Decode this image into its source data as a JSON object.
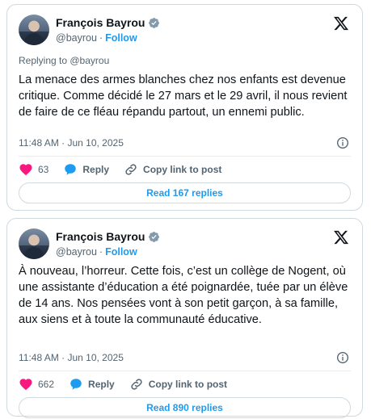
{
  "tweets": [
    {
      "author_name": "François Bayrou",
      "handle": "@bayrou",
      "separator": "·",
      "follow_label": "Follow",
      "replying_to": "Replying to @bayrou",
      "text": "La menace des armes blanches chez nos enfants est devenue critique. Comme décidé le 27 mars et le 29 avril, il nous revient de faire de ce fléau répandu partout, un ennemi public.",
      "timestamp": "11:48 AM · Jun 10, 2025",
      "likes": "63",
      "reply_label": "Reply",
      "copy_label": "Copy link to post",
      "read_replies_label": "Read 167 replies"
    },
    {
      "author_name": "François Bayrou",
      "handle": "@bayrou",
      "separator": "·",
      "follow_label": "Follow",
      "text": "À nouveau, l’horreur. Cette fois, c’est un collège de Nogent, où une assistante d’éducation a été poignardée, tuée par un élève de 14 ans. Nos pensées vont à son petit garçon, à sa famille, aux siens et à toute la communauté éducative.",
      "timestamp": "11:48 AM · Jun 10, 2025",
      "likes": "662",
      "reply_label": "Reply",
      "copy_label": "Copy link to post",
      "read_replies_label": "Read 890 replies"
    }
  ],
  "colors": {
    "accent": "#1d9bf0",
    "like": "#f91880",
    "text": "#0f1419",
    "muted": "#536471",
    "border": "#cfd9de"
  },
  "icons": [
    "verified-badge-icon",
    "x-logo-icon",
    "info-icon",
    "heart-icon",
    "reply-bubble-icon",
    "link-icon"
  ]
}
